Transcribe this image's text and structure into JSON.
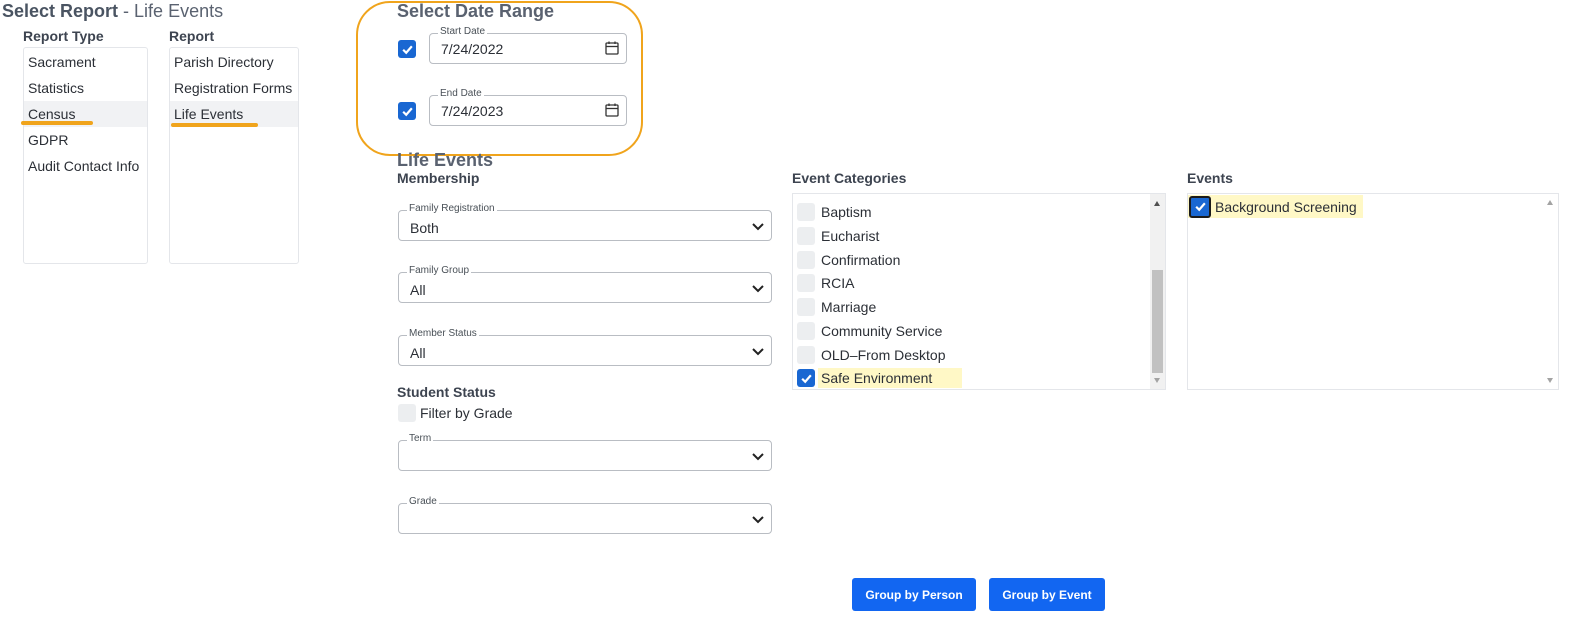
{
  "header": {
    "title_bold": "Select Report",
    "title_rest": " - Life Events"
  },
  "report_type": {
    "label": "Report Type",
    "items": [
      "Sacrament",
      "Statistics",
      "Census",
      "GDPR",
      "Audit Contact Info"
    ],
    "selected": "Census"
  },
  "report": {
    "label": "Report",
    "items": [
      "Parish Directory",
      "Registration Forms",
      "Life Events"
    ],
    "selected": "Life Events"
  },
  "date_range": {
    "title": "Select Date Range",
    "start": {
      "label": "Start Date",
      "value": "7/24/2022",
      "checked": true
    },
    "end": {
      "label": "End Date",
      "value": "7/24/2023",
      "checked": true
    }
  },
  "life_events": {
    "title": "Life Events",
    "membership": {
      "title": "Membership",
      "family_registration": {
        "label": "Family Registration",
        "value": "Both"
      },
      "family_group": {
        "label": "Family Group",
        "value": "All"
      },
      "member_status": {
        "label": "Member Status",
        "value": "All"
      }
    },
    "student_status": {
      "title": "Student Status",
      "filter_by_grade": {
        "label": "Filter by Grade",
        "checked": false
      },
      "term": {
        "label": "Term",
        "value": ""
      },
      "grade": {
        "label": "Grade",
        "value": ""
      }
    }
  },
  "event_categories": {
    "title": "Event Categories",
    "items": [
      {
        "label": "Baptism",
        "checked": false
      },
      {
        "label": "Eucharist",
        "checked": false
      },
      {
        "label": "Confirmation",
        "checked": false
      },
      {
        "label": "RCIA",
        "checked": false
      },
      {
        "label": "Marriage",
        "checked": false
      },
      {
        "label": "Community Service",
        "checked": false
      },
      {
        "label": "OLD–From Desktop",
        "checked": false
      },
      {
        "label": "Safe Environment",
        "checked": true
      }
    ]
  },
  "events": {
    "title": "Events",
    "items": [
      {
        "label": "Background Screening",
        "checked": true
      }
    ]
  },
  "buttons": {
    "group_by_person": "Group by Person",
    "group_by_event": "Group by Event"
  },
  "colors": {
    "accent": "#1266f1",
    "highlight_ring": "#f0a41c",
    "checkbox_on": "#1967d2",
    "row_highlight": "#fff8c6"
  }
}
